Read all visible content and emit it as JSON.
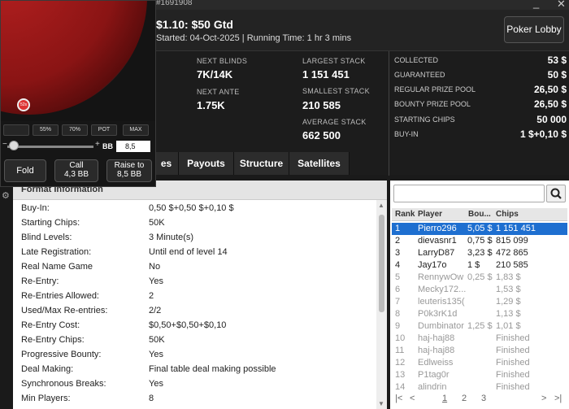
{
  "titlebar": {
    "id": "#1691908",
    "minimize": "_",
    "close": "✕"
  },
  "header": {
    "title": "$1.10: $50 Gtd",
    "subtitle": "Started: 04-Oct-2025  | Running Time: 1 hr  3 mins",
    "lobby_button": "Poker Lobby"
  },
  "stats": {
    "next_blinds_label": "NEXT BLINDS",
    "next_blinds": "7K/14K",
    "next_ante_label": "NEXT ANTE",
    "next_ante": "1.75K",
    "largest_stack_label": "LARGEST STACK",
    "largest_stack": "1 151 451",
    "smallest_stack_label": "SMALLEST STACK",
    "smallest_stack": "210 585",
    "average_stack_label": "AVERAGE STACK",
    "average_stack": "662 500"
  },
  "prizes": [
    {
      "label": "COLLECTED",
      "value": "53 $"
    },
    {
      "label": "GUARANTEED",
      "value": "50 $"
    },
    {
      "label": "REGULAR PRIZE POOL",
      "value": "26,50 $"
    },
    {
      "label": "BOUNTY PRIZE POOL",
      "value": "26,50 $"
    },
    {
      "label": "STARTING CHIPS",
      "value": "50 000"
    },
    {
      "label": "BUY-IN",
      "value": "1 $+0,10 $"
    }
  ],
  "tabs": [
    "es",
    "Payouts",
    "Structure",
    "Satellites"
  ],
  "info": {
    "title": "Format Information",
    "rows": [
      {
        "k": "Buy-In:",
        "v": "0,50 $+0,50 $+0,10 $"
      },
      {
        "k": "Starting Chips:",
        "v": "50K"
      },
      {
        "k": "Blind Levels:",
        "v": "3 Minute(s)"
      },
      {
        "k": "Late Registration:",
        "v": "Until end of level 14"
      },
      {
        "k": "Real Name Game",
        "v": "No"
      },
      {
        "k": "Re-Entry:",
        "v": "Yes"
      },
      {
        "k": "Re-Entries Allowed:",
        "v": "2"
      },
      {
        "k": "Used/Max Re-entries:",
        "v": "2/2"
      },
      {
        "k": "Re-Entry Cost:",
        "v": "$0,50+$0,50+$0,10"
      },
      {
        "k": "Re-Entry Chips:",
        "v": "50K"
      },
      {
        "k": "Progressive Bounty:",
        "v": "Yes"
      },
      {
        "k": "Deal Making:",
        "v": "Final table deal making possible"
      },
      {
        "k": "Synchronous Breaks:",
        "v": "Yes"
      },
      {
        "k": "Min Players:",
        "v": "8"
      }
    ]
  },
  "players": {
    "headers": {
      "rank": "Rank",
      "player": "Player",
      "bounty": "Bou...",
      "chips": "Chips"
    },
    "rows": [
      {
        "rank": "1",
        "player": "Pierro296",
        "bounty": "5,05 $",
        "chips": "1 151 451"
      },
      {
        "rank": "2",
        "player": "dievasnr1",
        "bounty": "0,75 $",
        "chips": "815 099"
      },
      {
        "rank": "3",
        "player": "LarryD87",
        "bounty": "3,23 $",
        "chips": "472 865"
      },
      {
        "rank": "4",
        "player": "Jay17o",
        "bounty": "1 $",
        "chips": "210 585"
      },
      {
        "rank": "5",
        "player": "RennywOw",
        "bounty": "0,25 $",
        "chips": "1,83 $"
      },
      {
        "rank": "6",
        "player": "Mecky172...",
        "bounty": "",
        "chips": "1,53 $"
      },
      {
        "rank": "7",
        "player": "leuteris135(",
        "bounty": "",
        "chips": "1,29 $"
      },
      {
        "rank": "8",
        "player": "P0k3rK1d",
        "bounty": "",
        "chips": "1,13 $"
      },
      {
        "rank": "9",
        "player": "Dumbinator",
        "bounty": "1,25 $",
        "chips": "1,01 $"
      },
      {
        "rank": "10",
        "player": "haj-haj88",
        "bounty": "",
        "chips": "Finished"
      },
      {
        "rank": "11",
        "player": "haj-haj88",
        "bounty": "",
        "chips": "Finished"
      },
      {
        "rank": "12",
        "player": "Edlweiss",
        "bounty": "",
        "chips": "Finished"
      },
      {
        "rank": "13",
        "player": "P1tag0r",
        "bounty": "",
        "chips": "Finished"
      },
      {
        "rank": "14",
        "player": "alindrin",
        "bounty": "",
        "chips": "Finished"
      }
    ],
    "pager": {
      "first": "|<",
      "prev": "<",
      "p1": "1",
      "p2": "2",
      "p3": "3",
      "next": ">",
      "last": ">|"
    }
  },
  "table": {
    "chip_label": "52s",
    "bet_buttons": [
      "",
      "55%",
      "70%",
      "POT",
      "MAX"
    ],
    "slider_minus": "−",
    "slider_plus": "+",
    "bb_label": "BB",
    "bb_value": "8,5",
    "fold": "Fold",
    "call_line1": "Call",
    "call_line2": "4,3 BB",
    "raise_line1": "Raise to",
    "raise_line2": "8,5 BB"
  }
}
